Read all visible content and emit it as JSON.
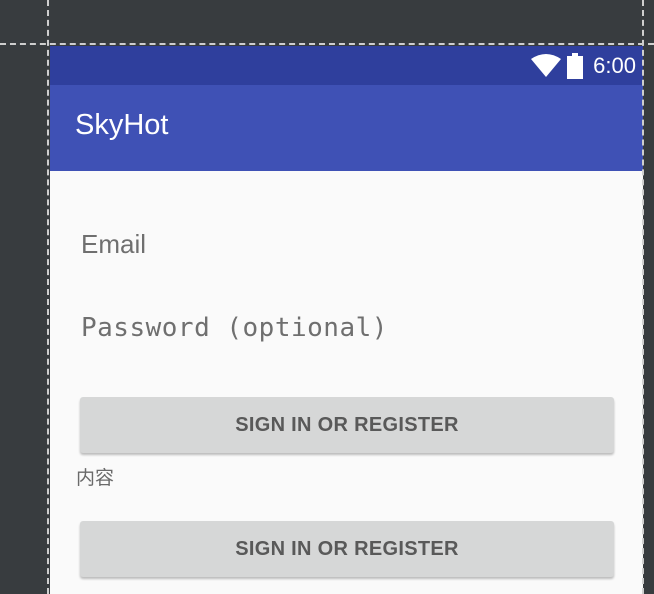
{
  "status_bar": {
    "time": "6:00",
    "icons": [
      "wifi-icon",
      "battery-icon"
    ]
  },
  "app_bar": {
    "title": "SkyHot"
  },
  "form": {
    "email_placeholder": "Email",
    "password_placeholder": "Password (optional)",
    "primary_button_label": "SIGN IN OR REGISTER",
    "content_label": "内容",
    "secondary_button_label": "SIGN IN OR REGISTER"
  },
  "colors": {
    "status_bar": "#2f3f9d",
    "app_bar": "#3f51b5",
    "button": "#d6d7d7",
    "editor_background": "#383c3f"
  }
}
